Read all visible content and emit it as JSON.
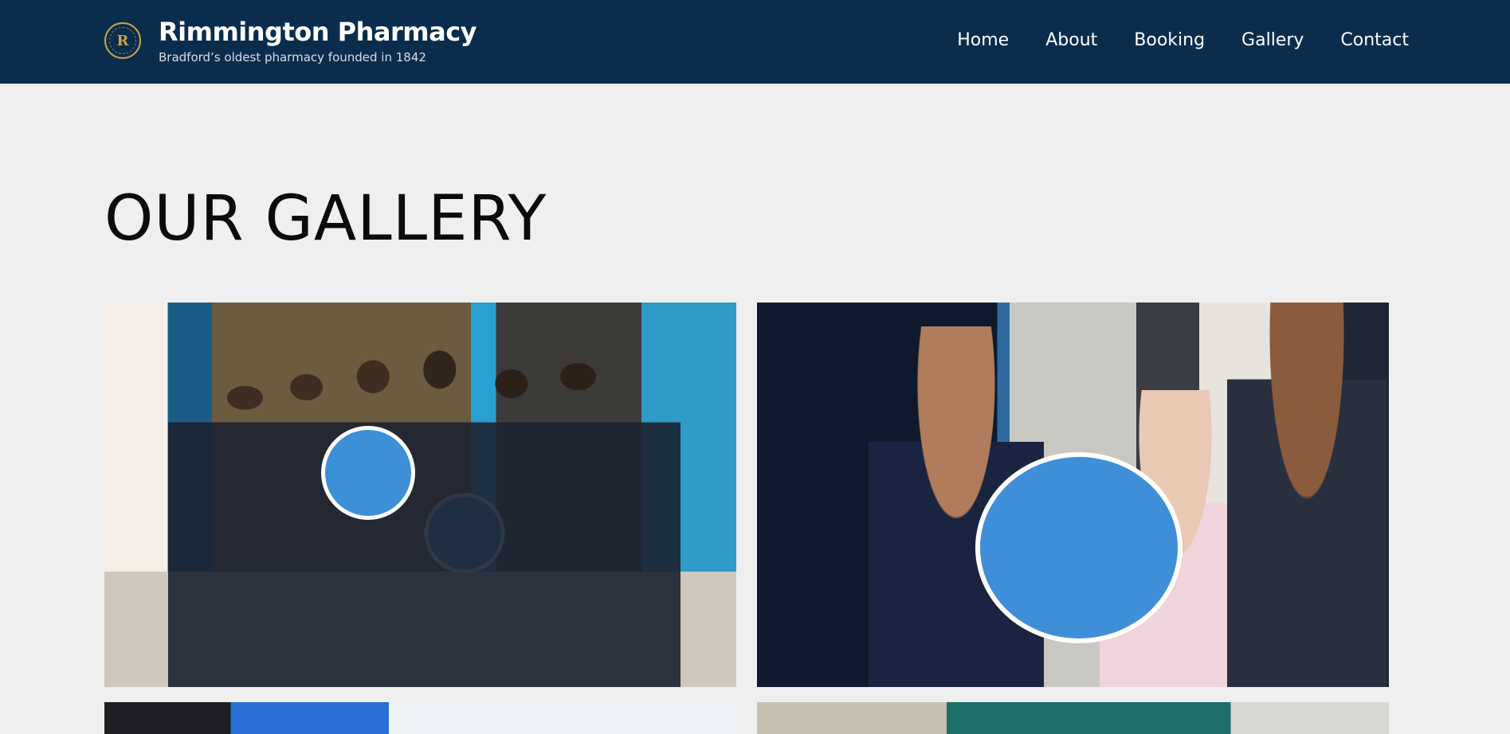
{
  "header": {
    "brand_title": "Rimmington Pharmacy",
    "brand_tagline": "Bradford’s oldest pharmacy founded in 1842",
    "logo_initials": "R",
    "nav": [
      {
        "label": "Home"
      },
      {
        "label": "About"
      },
      {
        "label": "Booking"
      },
      {
        "label": "Gallery"
      },
      {
        "label": "Contact"
      }
    ]
  },
  "main": {
    "page_title": "OUR GALLERY"
  },
  "colors": {
    "header_bg": "#0a2d4d",
    "page_bg": "#efefef",
    "logo_gold": "#c9a44a"
  }
}
